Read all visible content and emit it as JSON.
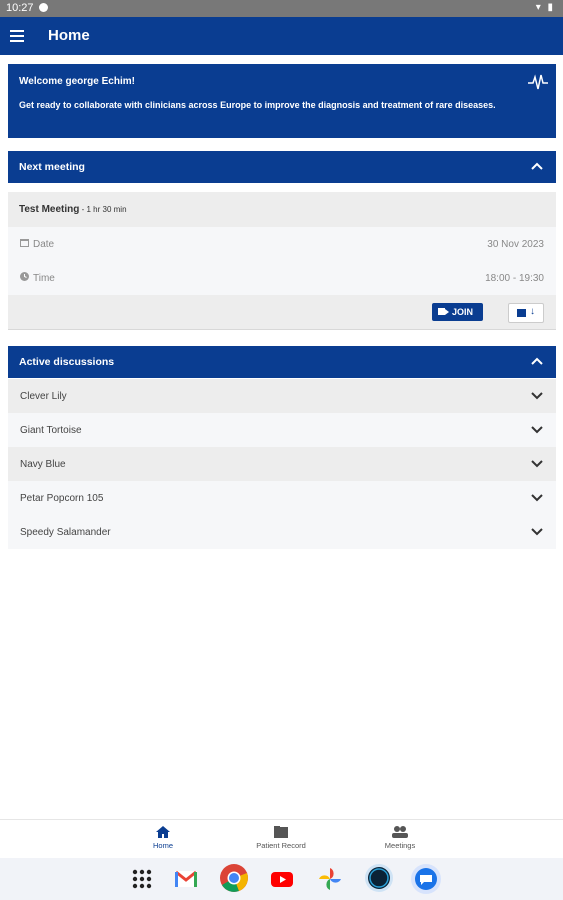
{
  "status_bar": {
    "time": "10:27"
  },
  "app_bar": {
    "title": "Home"
  },
  "welcome": {
    "heading": "Welcome george Echim!",
    "message": "Get ready to collaborate with clinicians across Europe to improve the diagnosis and treatment of rare diseases."
  },
  "next_meeting": {
    "section_title": "Next meeting",
    "meeting_name": "Test Meeting",
    "duration": " - 1 hr 30 min",
    "date_label": "Date",
    "date_value": "30 Nov 2023",
    "time_label": "Time",
    "time_value": "18:00 - 19:30",
    "join_label": "JOIN"
  },
  "active_discussions": {
    "section_title": "Active discussions",
    "items": [
      {
        "label": "Clever Lily"
      },
      {
        "label": "Giant Tortoise"
      },
      {
        "label": "Navy Blue"
      },
      {
        "label": "Petar Popcorn 105"
      },
      {
        "label": "Speedy Salamander"
      }
    ]
  },
  "bottom_nav": {
    "items": [
      {
        "label": "Home",
        "icon": "home-icon",
        "active": true
      },
      {
        "label": "Patient Record",
        "icon": "folder-icon"
      },
      {
        "label": "Meetings",
        "icon": "people-icon"
      }
    ]
  },
  "dock": {
    "apps": [
      "app-grid-icon",
      "gmail-icon",
      "chrome-icon",
      "youtube-icon",
      "photos-icon",
      "app-icon",
      "messages-icon"
    ]
  },
  "colors": {
    "primary": "#0a3d91",
    "row_grey": "#ededed",
    "row_light": "#f6f7f9"
  }
}
